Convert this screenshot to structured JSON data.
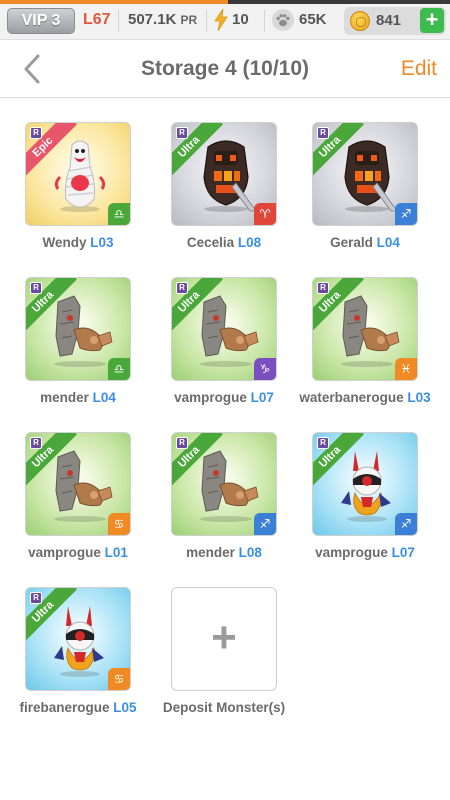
{
  "status_bar": {
    "vip": "VIP 3",
    "level": "L67",
    "power": "507.1K",
    "power_unit": "PR",
    "energy": "10",
    "paws": "65K",
    "gold": "841",
    "add_button": "+"
  },
  "header": {
    "title": "Storage 4 (10/10)",
    "edit": "Edit"
  },
  "monsters": [
    {
      "name": "Wendy",
      "level": "L03",
      "rarity_tag": "Epic",
      "rank": "R",
      "element": "earth",
      "element_glyph": "♎",
      "bg": "yellow",
      "art": "mummy-art"
    },
    {
      "name": "Cecelia",
      "level": "L08",
      "rarity_tag": "Ultra",
      "rank": "R",
      "element": "fire",
      "element_glyph": "♈",
      "bg": "grey",
      "art": "knight-art"
    },
    {
      "name": "Gerald",
      "level": "L04",
      "rarity_tag": "Ultra",
      "rank": "R",
      "element": "air",
      "element_glyph": "♐",
      "bg": "grey",
      "art": "knight-art"
    },
    {
      "name": "mender",
      "level": "L04",
      "rarity_tag": "Ultra",
      "rank": "R",
      "element": "earth",
      "element_glyph": "♎",
      "bg": "green",
      "art": "golem-art"
    },
    {
      "name": "vamprogue",
      "level": "L07",
      "rarity_tag": "Ultra",
      "rank": "R",
      "element": "dark",
      "element_glyph": "♑",
      "bg": "green",
      "art": "golem-art"
    },
    {
      "name": "waterbanerogue",
      "level": "L03",
      "rarity_tag": "Ultra",
      "rank": "R",
      "element": "light",
      "element_glyph": "♓",
      "bg": "green",
      "art": "golem-art"
    },
    {
      "name": "vamprogue",
      "level": "L01",
      "rarity_tag": "Ultra",
      "rank": "R",
      "element": "light",
      "element_glyph": "♋",
      "bg": "green",
      "art": "golem-art"
    },
    {
      "name": "mender",
      "level": "L08",
      "rarity_tag": "Ultra",
      "rank": "R",
      "element": "air",
      "element_glyph": "♐",
      "bg": "green",
      "art": "golem-art"
    },
    {
      "name": "vamprogue",
      "level": "L07",
      "rarity_tag": "Ultra",
      "rank": "R",
      "element": "air",
      "element_glyph": "♐",
      "bg": "blue",
      "art": "bunny-art"
    },
    {
      "name": "firebanerogue",
      "level": "L05",
      "rarity_tag": "Ultra",
      "rank": "R",
      "element": "light",
      "element_glyph": "♋",
      "bg": "blue",
      "art": "bunny-art"
    }
  ],
  "deposit": {
    "icon": "+",
    "label": "Deposit Monster(s)"
  },
  "colors": {
    "accent": "#f08a24",
    "level_blue": "#3a8ee6",
    "ultra_green": "#4aa83a",
    "epic_pink": "#e8566b"
  }
}
